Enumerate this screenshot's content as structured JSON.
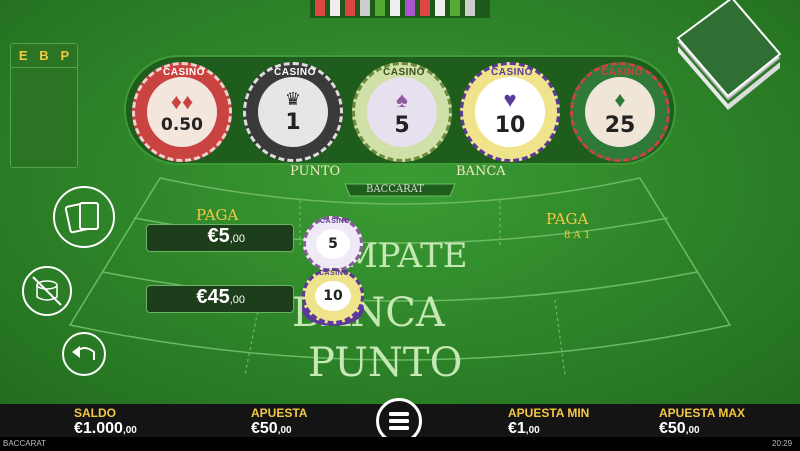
{
  "scoreboard": {
    "headers": [
      "E",
      "B",
      "P"
    ]
  },
  "chip_tray": {
    "chips": [
      {
        "value": "0.50",
        "brand": "CASINO",
        "suit": "diamond",
        "color": "#c94440"
      },
      {
        "value": "1",
        "brand": "CASINO",
        "suit": "crown",
        "color": "#3a3a3a"
      },
      {
        "value": "5",
        "brand": "CASINO",
        "suit": "spade",
        "color": "#8c5b9e"
      },
      {
        "value": "10",
        "brand": "CASINO",
        "suit": "heart",
        "color": "#5b3a9a"
      },
      {
        "value": "25",
        "brand": "CASINO",
        "suit": "diamond",
        "color": "#2f7a38"
      }
    ]
  },
  "table": {
    "punto_header": "PUNTO",
    "banca_header": "BANCA",
    "logo": "BACCARAT",
    "paga_left": "PAGA",
    "paga_right": "PAGA",
    "paga_right_sub": "8 A 1",
    "tie_label": "EMPATE",
    "banca_label": "BANCA",
    "punto_label": "PUNTO"
  },
  "bets": {
    "tie": {
      "amount": "€5",
      "cents": ",00",
      "chip_value": "5",
      "chip_brand": "CASINO"
    },
    "banca": {
      "amount": "€45",
      "cents": ",00",
      "chip_value": "10",
      "chip_brand": "CASINO"
    }
  },
  "side_buttons": [
    "cards-icon",
    "clear-chips-icon",
    "undo-icon"
  ],
  "bottom": {
    "saldo_label": "SALDO",
    "saldo_value": "€1.000",
    "saldo_cents": ",00",
    "apuesta_label": "APUESTA",
    "apuesta_value": "€50",
    "apuesta_cents": ",00",
    "min_label": "APUESTA MIN",
    "min_value": "€1",
    "min_cents": ",00",
    "max_label": "APUESTA MAX",
    "max_value": "€50",
    "max_cents": ",00"
  },
  "footer": {
    "game": "BACCARAT",
    "time": "20:29"
  }
}
